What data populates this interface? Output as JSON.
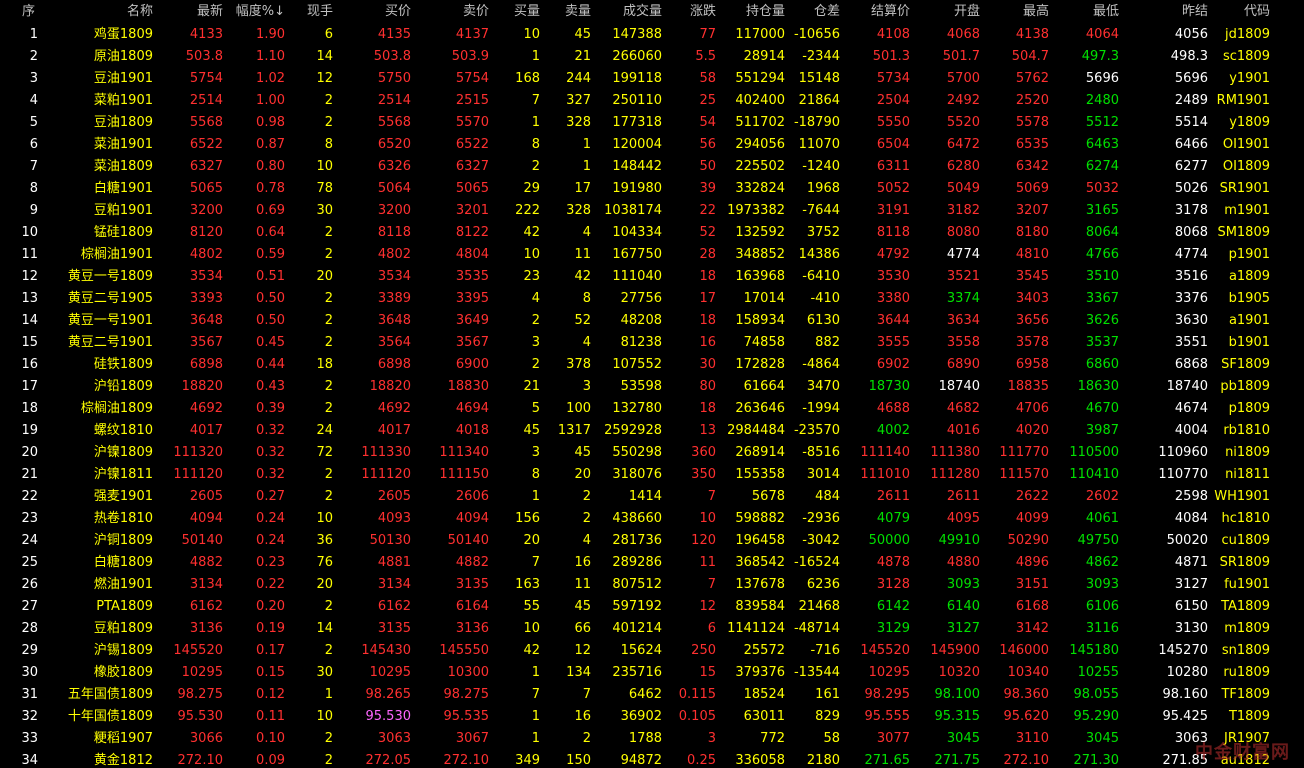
{
  "headers": {
    "seq": "序",
    "name": "名称",
    "last": "最新",
    "change_pct": "幅度%",
    "sort_indicator": "↓",
    "cur_hand": "现手",
    "bid": "买价",
    "ask": "卖价",
    "bid_vol": "买量",
    "ask_vol": "卖量",
    "volume": "成交量",
    "change": "涨跌",
    "open_interest": "持仓量",
    "oi_change": "仓差",
    "settle": "结算价",
    "open": "开盘",
    "high": "最高",
    "low": "最低",
    "prev_settle": "昨结",
    "code": "代码"
  },
  "colors": {
    "up": "#ff3030",
    "down": "#00e000",
    "flat": "#ffffff",
    "label": "#ffff00",
    "highlight": "#ff66ff"
  },
  "rows": [
    {
      "seq": "1",
      "name": "鸡蛋1809",
      "last": "4133",
      "pct": "1.90",
      "hand": "6",
      "bid": "4135",
      "ask": "4137",
      "bv": "10",
      "av": "45",
      "vol": "147388",
      "chg": "77",
      "oi": "117000",
      "oic": "-10656",
      "settle": "4108",
      "open": "4068",
      "high": "4138",
      "low": "4064",
      "prev": "4056",
      "code": "jd1809"
    },
    {
      "seq": "2",
      "name": "原油1809",
      "last": "503.8",
      "pct": "1.10",
      "hand": "14",
      "bid": "503.8",
      "ask": "503.9",
      "bv": "1",
      "av": "21",
      "vol": "266060",
      "chg": "5.5",
      "oi": "28914",
      "oic": "-2344",
      "settle": "501.3",
      "open": "501.7",
      "high": "504.7",
      "low": "497.3",
      "prev": "498.3",
      "code": "sc1809"
    },
    {
      "seq": "3",
      "name": "豆油1901",
      "last": "5754",
      "pct": "1.02",
      "hand": "12",
      "bid": "5750",
      "ask": "5754",
      "bv": "168",
      "av": "244",
      "vol": "199118",
      "chg": "58",
      "oi": "551294",
      "oic": "15148",
      "settle": "5734",
      "open": "5700",
      "high": "5762",
      "low": "5696",
      "prev": "5696",
      "code": "y1901"
    },
    {
      "seq": "4",
      "name": "菜粕1901",
      "last": "2514",
      "pct": "1.00",
      "hand": "2",
      "bid": "2514",
      "ask": "2515",
      "bv": "7",
      "av": "327",
      "vol": "250110",
      "chg": "25",
      "oi": "402400",
      "oic": "21864",
      "settle": "2504",
      "open": "2492",
      "high": "2520",
      "low": "2480",
      "prev": "2489",
      "code": "RM1901"
    },
    {
      "seq": "5",
      "name": "豆油1809",
      "last": "5568",
      "pct": "0.98",
      "hand": "2",
      "bid": "5568",
      "ask": "5570",
      "bv": "1",
      "av": "328",
      "vol": "177318",
      "chg": "54",
      "oi": "511702",
      "oic": "-18790",
      "settle": "5550",
      "open": "5520",
      "high": "5578",
      "low": "5512",
      "prev": "5514",
      "code": "y1809"
    },
    {
      "seq": "6",
      "name": "菜油1901",
      "last": "6522",
      "pct": "0.87",
      "hand": "8",
      "bid": "6520",
      "ask": "6522",
      "bv": "8",
      "av": "1",
      "vol": "120004",
      "chg": "56",
      "oi": "294056",
      "oic": "11070",
      "settle": "6504",
      "open": "6472",
      "high": "6535",
      "low": "6463",
      "prev": "6466",
      "code": "OI1901"
    },
    {
      "seq": "7",
      "name": "菜油1809",
      "last": "6327",
      "pct": "0.80",
      "hand": "10",
      "bid": "6326",
      "ask": "6327",
      "bv": "2",
      "av": "1",
      "vol": "148442",
      "chg": "50",
      "oi": "225502",
      "oic": "-1240",
      "settle": "6311",
      "open": "6280",
      "high": "6342",
      "low": "6274",
      "prev": "6277",
      "code": "OI1809"
    },
    {
      "seq": "8",
      "name": "白糖1901",
      "last": "5065",
      "pct": "0.78",
      "hand": "78",
      "bid": "5064",
      "ask": "5065",
      "bv": "29",
      "av": "17",
      "vol": "191980",
      "chg": "39",
      "oi": "332824",
      "oic": "1968",
      "settle": "5052",
      "open": "5049",
      "high": "5069",
      "low": "5032",
      "prev": "5026",
      "code": "SR1901"
    },
    {
      "seq": "9",
      "name": "豆粕1901",
      "last": "3200",
      "pct": "0.69",
      "hand": "30",
      "bid": "3200",
      "ask": "3201",
      "bv": "222",
      "av": "328",
      "vol": "1038174",
      "chg": "22",
      "oi": "1973382",
      "oic": "-7644",
      "settle": "3191",
      "open": "3182",
      "high": "3207",
      "low": "3165",
      "prev": "3178",
      "code": "m1901"
    },
    {
      "seq": "10",
      "name": "锰硅1809",
      "last": "8120",
      "pct": "0.64",
      "hand": "2",
      "bid": "8118",
      "ask": "8122",
      "bv": "42",
      "av": "4",
      "vol": "104334",
      "chg": "52",
      "oi": "132592",
      "oic": "3752",
      "settle": "8118",
      "open": "8080",
      "high": "8180",
      "low": "8064",
      "prev": "8068",
      "code": "SM1809"
    },
    {
      "seq": "11",
      "name": "棕榈油1901",
      "last": "4802",
      "pct": "0.59",
      "hand": "2",
      "bid": "4802",
      "ask": "4804",
      "bv": "10",
      "av": "11",
      "vol": "167750",
      "chg": "28",
      "oi": "348852",
      "oic": "14386",
      "settle": "4792",
      "open": "4774",
      "high": "4810",
      "low": "4766",
      "prev": "4774",
      "code": "p1901"
    },
    {
      "seq": "12",
      "name": "黄豆一号1809",
      "last": "3534",
      "pct": "0.51",
      "hand": "20",
      "bid": "3534",
      "ask": "3535",
      "bv": "23",
      "av": "42",
      "vol": "111040",
      "chg": "18",
      "oi": "163968",
      "oic": "-6410",
      "settle": "3530",
      "open": "3521",
      "high": "3545",
      "low": "3510",
      "prev": "3516",
      "code": "a1809"
    },
    {
      "seq": "13",
      "name": "黄豆二号1905",
      "last": "3393",
      "pct": "0.50",
      "hand": "2",
      "bid": "3389",
      "ask": "3395",
      "bv": "4",
      "av": "8",
      "vol": "27756",
      "chg": "17",
      "oi": "17014",
      "oic": "-410",
      "settle": "3380",
      "open": "3374",
      "high": "3403",
      "low": "3367",
      "prev": "3376",
      "code": "b1905"
    },
    {
      "seq": "14",
      "name": "黄豆一号1901",
      "last": "3648",
      "pct": "0.50",
      "hand": "2",
      "bid": "3648",
      "ask": "3649",
      "bv": "2",
      "av": "52",
      "vol": "48208",
      "chg": "18",
      "oi": "158934",
      "oic": "6130",
      "settle": "3644",
      "open": "3634",
      "high": "3656",
      "low": "3626",
      "prev": "3630",
      "code": "a1901"
    },
    {
      "seq": "15",
      "name": "黄豆二号1901",
      "last": "3567",
      "pct": "0.45",
      "hand": "2",
      "bid": "3564",
      "ask": "3567",
      "bv": "3",
      "av": "4",
      "vol": "81238",
      "chg": "16",
      "oi": "74858",
      "oic": "882",
      "settle": "3555",
      "open": "3558",
      "high": "3578",
      "low": "3537",
      "prev": "3551",
      "code": "b1901"
    },
    {
      "seq": "16",
      "name": "硅铁1809",
      "last": "6898",
      "pct": "0.44",
      "hand": "18",
      "bid": "6898",
      "ask": "6900",
      "bv": "2",
      "av": "378",
      "vol": "107552",
      "chg": "30",
      "oi": "172828",
      "oic": "-4864",
      "settle": "6902",
      "open": "6890",
      "high": "6958",
      "low": "6860",
      "prev": "6868",
      "code": "SF1809"
    },
    {
      "seq": "17",
      "name": "沪铅1809",
      "last": "18820",
      "pct": "0.43",
      "hand": "2",
      "bid": "18820",
      "ask": "18830",
      "bv": "21",
      "av": "3",
      "vol": "53598",
      "chg": "80",
      "oi": "61664",
      "oic": "3470",
      "settle": "18730",
      "open": "18740",
      "high": "18835",
      "low": "18630",
      "prev": "18740",
      "code": "pb1809"
    },
    {
      "seq": "18",
      "name": "棕榈油1809",
      "last": "4692",
      "pct": "0.39",
      "hand": "2",
      "bid": "4692",
      "ask": "4694",
      "bv": "5",
      "av": "100",
      "vol": "132780",
      "chg": "18",
      "oi": "263646",
      "oic": "-1994",
      "settle": "4688",
      "open": "4682",
      "high": "4706",
      "low": "4670",
      "prev": "4674",
      "code": "p1809"
    },
    {
      "seq": "19",
      "name": "螺纹1810",
      "last": "4017",
      "pct": "0.32",
      "hand": "24",
      "bid": "4017",
      "ask": "4018",
      "bv": "45",
      "av": "1317",
      "vol": "2592928",
      "chg": "13",
      "oi": "2984484",
      "oic": "-23570",
      "settle": "4002",
      "open": "4016",
      "high": "4020",
      "low": "3987",
      "prev": "4004",
      "code": "rb1810"
    },
    {
      "seq": "20",
      "name": "沪镍1809",
      "last": "111320",
      "pct": "0.32",
      "hand": "72",
      "bid": "111330",
      "ask": "111340",
      "bv": "3",
      "av": "45",
      "vol": "550298",
      "chg": "360",
      "oi": "268914",
      "oic": "-8516",
      "settle": "111140",
      "open": "111380",
      "high": "111770",
      "low": "110500",
      "prev": "110960",
      "code": "ni1809"
    },
    {
      "seq": "21",
      "name": "沪镍1811",
      "last": "111120",
      "pct": "0.32",
      "hand": "2",
      "bid": "111120",
      "ask": "111150",
      "bv": "8",
      "av": "20",
      "vol": "318076",
      "chg": "350",
      "oi": "155358",
      "oic": "3014",
      "settle": "111010",
      "open": "111280",
      "high": "111570",
      "low": "110410",
      "prev": "110770",
      "code": "ni1811"
    },
    {
      "seq": "22",
      "name": "强麦1901",
      "last": "2605",
      "pct": "0.27",
      "hand": "2",
      "bid": "2605",
      "ask": "2606",
      "bv": "1",
      "av": "2",
      "vol": "1414",
      "chg": "7",
      "oi": "5678",
      "oic": "484",
      "settle": "2611",
      "open": "2611",
      "high": "2622",
      "low": "2602",
      "prev": "2598",
      "code": "WH1901"
    },
    {
      "seq": "23",
      "name": "热卷1810",
      "last": "4094",
      "pct": "0.24",
      "hand": "10",
      "bid": "4093",
      "ask": "4094",
      "bv": "156",
      "av": "2",
      "vol": "438660",
      "chg": "10",
      "oi": "598882",
      "oic": "-2936",
      "settle": "4079",
      "open": "4095",
      "high": "4099",
      "low": "4061",
      "prev": "4084",
      "code": "hc1810"
    },
    {
      "seq": "24",
      "name": "沪铜1809",
      "last": "50140",
      "pct": "0.24",
      "hand": "36",
      "bid": "50130",
      "ask": "50140",
      "bv": "20",
      "av": "4",
      "vol": "281736",
      "chg": "120",
      "oi": "196458",
      "oic": "-3042",
      "settle": "50000",
      "open": "49910",
      "high": "50290",
      "low": "49750",
      "prev": "50020",
      "code": "cu1809"
    },
    {
      "seq": "25",
      "name": "白糖1809",
      "last": "4882",
      "pct": "0.23",
      "hand": "76",
      "bid": "4881",
      "ask": "4882",
      "bv": "7",
      "av": "16",
      "vol": "289286",
      "chg": "11",
      "oi": "368542",
      "oic": "-16524",
      "settle": "4878",
      "open": "4880",
      "high": "4896",
      "low": "4862",
      "prev": "4871",
      "code": "SR1809"
    },
    {
      "seq": "26",
      "name": "燃油1901",
      "last": "3134",
      "pct": "0.22",
      "hand": "20",
      "bid": "3134",
      "ask": "3135",
      "bv": "163",
      "av": "11",
      "vol": "807512",
      "chg": "7",
      "oi": "137678",
      "oic": "6236",
      "settle": "3128",
      "open": "3093",
      "high": "3151",
      "low": "3093",
      "prev": "3127",
      "code": "fu1901"
    },
    {
      "seq": "27",
      "name": "PTA1809",
      "last": "6162",
      "pct": "0.20",
      "hand": "2",
      "bid": "6162",
      "ask": "6164",
      "bv": "55",
      "av": "45",
      "vol": "597192",
      "chg": "12",
      "oi": "839584",
      "oic": "21468",
      "settle": "6142",
      "open": "6140",
      "high": "6168",
      "low": "6106",
      "prev": "6150",
      "code": "TA1809"
    },
    {
      "seq": "28",
      "name": "豆粕1809",
      "last": "3136",
      "pct": "0.19",
      "hand": "14",
      "bid": "3135",
      "ask": "3136",
      "bv": "10",
      "av": "66",
      "vol": "401214",
      "chg": "6",
      "oi": "1141124",
      "oic": "-48714",
      "settle": "3129",
      "open": "3127",
      "high": "3142",
      "low": "3116",
      "prev": "3130",
      "code": "m1809"
    },
    {
      "seq": "29",
      "name": "沪锡1809",
      "last": "145520",
      "pct": "0.17",
      "hand": "2",
      "bid": "145430",
      "ask": "145550",
      "bv": "42",
      "av": "12",
      "vol": "15624",
      "chg": "250",
      "oi": "25572",
      "oic": "-716",
      "settle": "145520",
      "open": "145900",
      "high": "146000",
      "low": "145180",
      "prev": "145270",
      "code": "sn1809"
    },
    {
      "seq": "30",
      "name": "橡胶1809",
      "last": "10295",
      "pct": "0.15",
      "hand": "30",
      "bid": "10295",
      "ask": "10300",
      "bv": "1",
      "av": "134",
      "vol": "235716",
      "chg": "15",
      "oi": "379376",
      "oic": "-13544",
      "settle": "10295",
      "open": "10320",
      "high": "10340",
      "low": "10255",
      "prev": "10280",
      "code": "ru1809"
    },
    {
      "seq": "31",
      "name": "五年国债1809",
      "last": "98.275",
      "pct": "0.12",
      "hand": "1",
      "bid": "98.265",
      "ask": "98.275",
      "bv": "7",
      "av": "7",
      "vol": "6462",
      "chg": "0.115",
      "oi": "18524",
      "oic": "161",
      "settle": "98.295",
      "open": "98.100",
      "high": "98.360",
      "low": "98.055",
      "prev": "98.160",
      "code": "TF1809"
    },
    {
      "seq": "32",
      "name": "十年国债1809",
      "last": "95.530",
      "pct": "0.11",
      "hand": "10",
      "bid": "95.530",
      "ask": "95.535",
      "bv": "1",
      "av": "16",
      "vol": "36902",
      "chg": "0.105",
      "oi": "63011",
      "oic": "829",
      "settle": "95.555",
      "open": "95.315",
      "high": "95.620",
      "low": "95.290",
      "prev": "95.425",
      "code": "T1809"
    },
    {
      "seq": "33",
      "name": "粳稻1907",
      "last": "3066",
      "pct": "0.10",
      "hand": "2",
      "bid": "3063",
      "ask": "3067",
      "bv": "1",
      "av": "2",
      "vol": "1788",
      "chg": "3",
      "oi": "772",
      "oic": "58",
      "settle": "3077",
      "open": "3045",
      "high": "3110",
      "low": "3045",
      "prev": "3063",
      "code": "JR1907"
    },
    {
      "seq": "34",
      "name": "黄金1812",
      "last": "272.10",
      "pct": "0.09",
      "hand": "2",
      "bid": "272.05",
      "ask": "272.10",
      "bv": "349",
      "av": "150",
      "vol": "94872",
      "chg": "0.25",
      "oi": "336058",
      "oic": "2180",
      "settle": "271.65",
      "open": "271.75",
      "high": "272.10",
      "low": "271.30",
      "prev": "271.85",
      "code": "au1812"
    }
  ],
  "watermark": "中金财富网"
}
